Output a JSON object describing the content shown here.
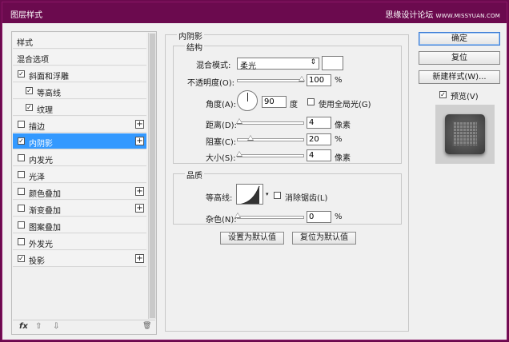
{
  "window": {
    "title": "图层样式",
    "watermark": "思缘设计论坛",
    "watermark_url": "WWW.MISSYUAN.COM"
  },
  "left_panel": {
    "items": [
      {
        "label": "样式",
        "checkbox": false,
        "checked": false,
        "plus": false,
        "selected": false,
        "indent": 0
      },
      {
        "label": "混合选项",
        "checkbox": false,
        "checked": false,
        "plus": false,
        "selected": false,
        "indent": 0
      },
      {
        "label": "斜面和浮雕",
        "checkbox": true,
        "checked": true,
        "plus": false,
        "selected": false,
        "indent": 0
      },
      {
        "label": "等高线",
        "checkbox": true,
        "checked": true,
        "plus": false,
        "selected": false,
        "indent": 1
      },
      {
        "label": "纹理",
        "checkbox": true,
        "checked": true,
        "plus": false,
        "selected": false,
        "indent": 1
      },
      {
        "label": "描边",
        "checkbox": true,
        "checked": false,
        "plus": true,
        "selected": false,
        "indent": 0
      },
      {
        "label": "内阴影",
        "checkbox": true,
        "checked": true,
        "plus": true,
        "selected": true,
        "indent": 0
      },
      {
        "label": "内发光",
        "checkbox": true,
        "checked": false,
        "plus": false,
        "selected": false,
        "indent": 0
      },
      {
        "label": "光泽",
        "checkbox": true,
        "checked": false,
        "plus": false,
        "selected": false,
        "indent": 0
      },
      {
        "label": "颜色叠加",
        "checkbox": true,
        "checked": false,
        "plus": true,
        "selected": false,
        "indent": 0
      },
      {
        "label": "渐变叠加",
        "checkbox": true,
        "checked": false,
        "plus": true,
        "selected": false,
        "indent": 0
      },
      {
        "label": "图案叠加",
        "checkbox": true,
        "checked": false,
        "plus": false,
        "selected": false,
        "indent": 0
      },
      {
        "label": "外发光",
        "checkbox": true,
        "checked": false,
        "plus": false,
        "selected": false,
        "indent": 0
      },
      {
        "label": "投影",
        "checkbox": true,
        "checked": true,
        "plus": true,
        "selected": false,
        "indent": 0
      }
    ],
    "footer": {
      "fx": "fx",
      "up": "⇧",
      "down": "⇩",
      "trash": "🗑"
    }
  },
  "inner_shadow": {
    "section_title": "内阴影",
    "structure": {
      "title": "结构",
      "blend_mode_label": "混合模式:",
      "blend_mode_value": "柔光",
      "opacity_label": "不透明度(O):",
      "opacity_value": "100",
      "opacity_fraction": 1.0,
      "percent": "%",
      "angle_label": "角度(A):",
      "angle_value": "90",
      "angle_unit": "度",
      "global_light_label": "使用全局光(G)",
      "distance_label": "距离(D):",
      "distance_value": "4",
      "distance_fraction": 0.02,
      "choke_label": "阻塞(C):",
      "choke_value": "20",
      "choke_fraction": 0.2,
      "size_label": "大小(S):",
      "size_value": "4",
      "size_fraction": 0.02,
      "px_unit": "像素"
    },
    "quality": {
      "title": "品质",
      "contour_label": "等高线:",
      "antialias_label": "消除锯齿(L)",
      "noise_label": "杂色(N):",
      "noise_value": "0",
      "noise_fraction": 0.0
    },
    "make_default": "设置为默认值",
    "reset_default": "复位为默认值"
  },
  "buttons": {
    "ok": "确定",
    "reset": "复位",
    "new_style": "新建样式(W)...",
    "preview_label": "预览(V)",
    "preview_checked": true
  }
}
